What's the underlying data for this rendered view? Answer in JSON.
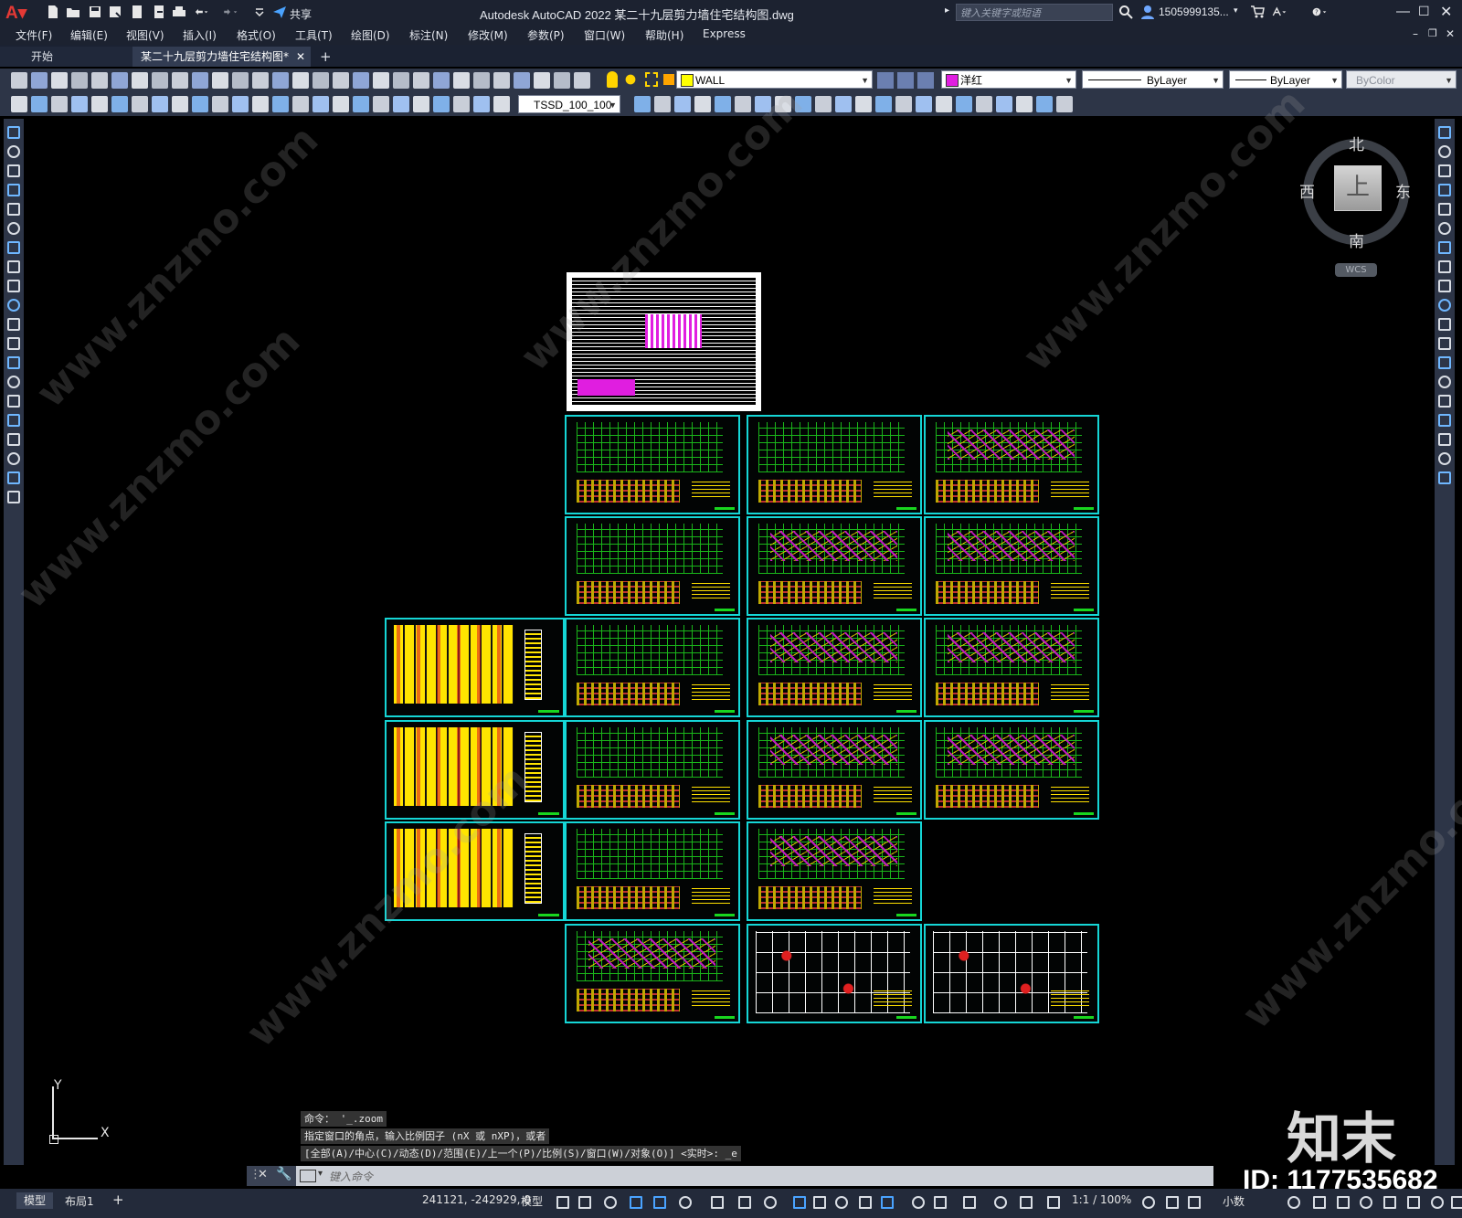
{
  "app": {
    "title": "Autodesk AutoCAD 2022    某二十九层剪力墙住宅结构图.dwg",
    "share_label": "共享",
    "search_placeholder": "键入关键字或短语",
    "user": "1505999135...",
    "window_controls": [
      "minimize-icon",
      "maximize-icon",
      "close-icon"
    ]
  },
  "menu": [
    "文件(F)",
    "编辑(E)",
    "视图(V)",
    "插入(I)",
    "格式(O)",
    "工具(T)",
    "绘图(D)",
    "标注(N)",
    "修改(M)",
    "参数(P)",
    "窗口(W)",
    "帮助(H)",
    "Express"
  ],
  "tabs": [
    {
      "label": "开始",
      "active": false
    },
    {
      "label": "某二十九层剪力墙住宅结构图*",
      "active": true
    }
  ],
  "toolbar": {
    "layer": "WALL",
    "color": "洋红",
    "linetype": "ByLayer",
    "lineweight": "ByLayer",
    "plotstyle": "ByColor",
    "dimstyle": "TSSD_100_100"
  },
  "viewcube": {
    "north": "北",
    "south": "南",
    "east": "东",
    "west": "西",
    "top": "上",
    "wcs": "WCS"
  },
  "ucs": {
    "x": "X",
    "y": "Y"
  },
  "command_history": [
    "命令： '_.zoom",
    "指定窗口的角点，输入比例因子 (nX 或 nXP)，或者",
    "[全部(A)/中心(C)/动态(D)/范围(E)/上一个(P)/比例(S)/窗口(W)/对象(O)] <实时>: _e"
  ],
  "command_placeholder": "键入命令",
  "layout_tabs": [
    "模型",
    "布局1"
  ],
  "status": {
    "coords": "241121, -242929, 0",
    "space": "模型",
    "scale": "1:1 / 100%",
    "units": "小数"
  },
  "watermark": {
    "brand": "知末",
    "id": "ID: 1177535682",
    "site": "www.znzmo.com"
  },
  "colors": {
    "sheet_border": "#15d6d6",
    "accent_magenta": "#e01ee0",
    "plan_green": "#1fd61f",
    "detail_yellow": "#ffe000"
  }
}
